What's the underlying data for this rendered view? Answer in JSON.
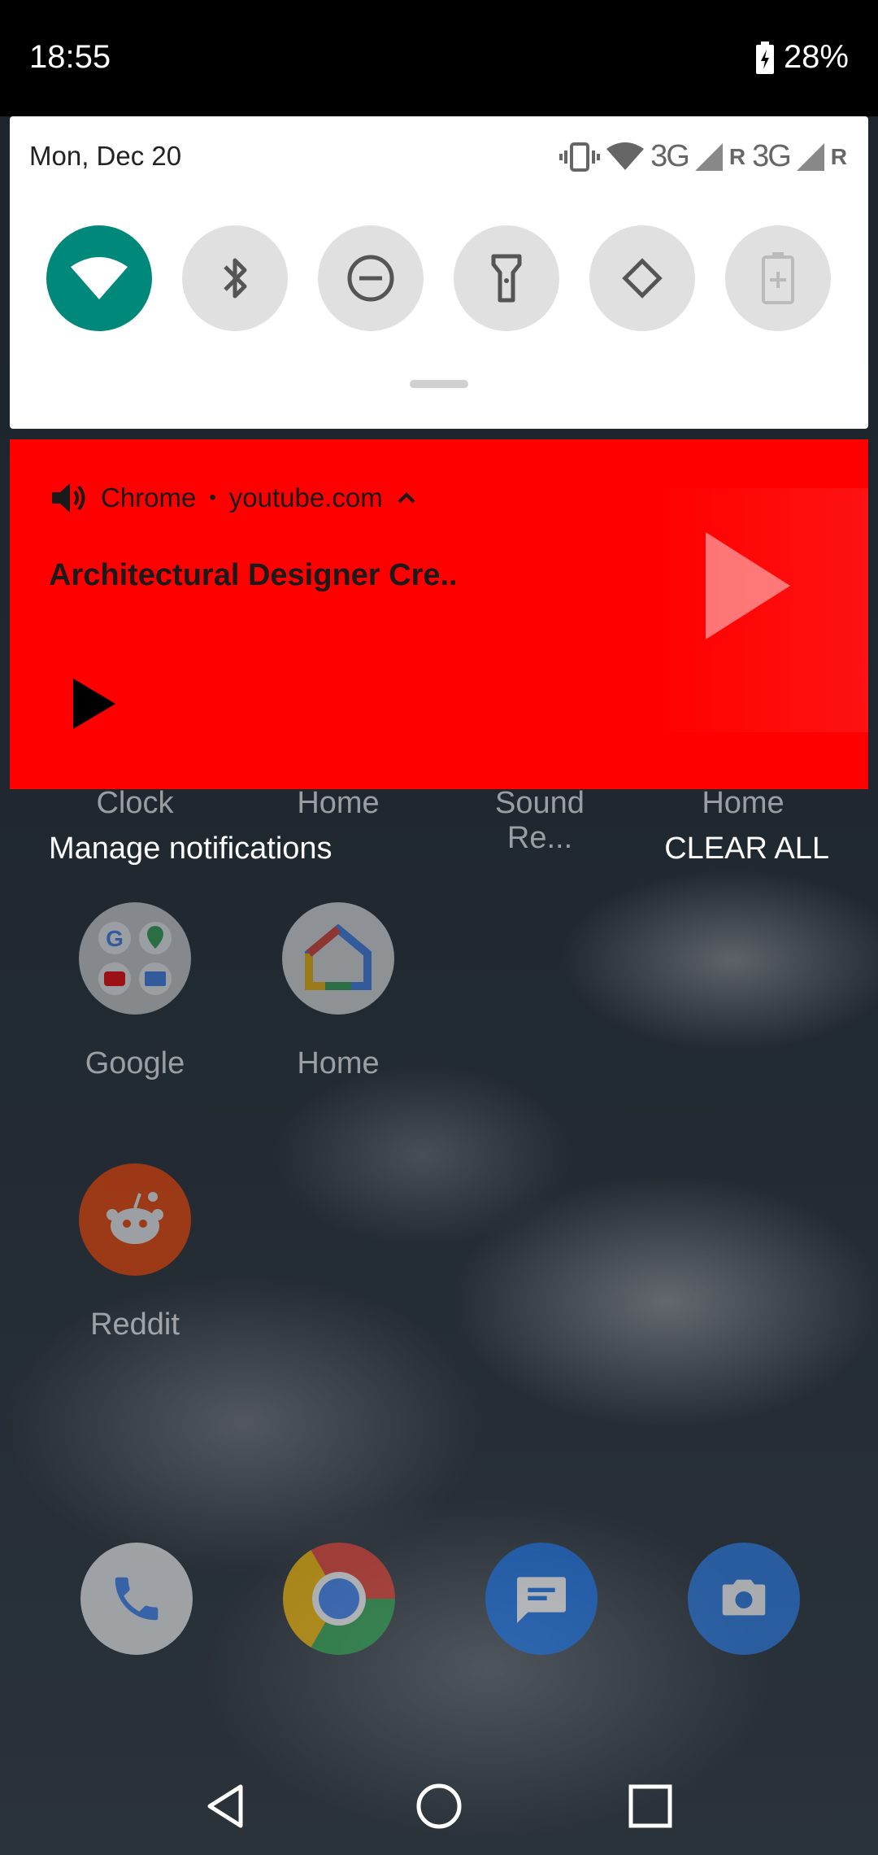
{
  "status_bar": {
    "time": "18:55",
    "battery_percent": "28%"
  },
  "quick_settings": {
    "date": "Mon, Dec 20",
    "network_labels": [
      "3G",
      "R",
      "3G",
      "R"
    ],
    "tiles": [
      {
        "name": "wifi",
        "icon": "wifi-icon",
        "active": true
      },
      {
        "name": "bluetooth",
        "icon": "bluetooth-icon",
        "active": false
      },
      {
        "name": "do-not-disturb",
        "icon": "dnd-icon",
        "active": false
      },
      {
        "name": "flashlight",
        "icon": "flashlight-icon",
        "active": false
      },
      {
        "name": "auto-rotate",
        "icon": "rotate-icon",
        "active": false
      },
      {
        "name": "battery-saver",
        "icon": "battery-saver-icon",
        "active": false
      }
    ],
    "accent_color": "#00897b"
  },
  "media_notification": {
    "app": "Chrome",
    "separator": "•",
    "site": "youtube.com",
    "title": "Architectural Designer Cre..",
    "background_color": "#ff0000"
  },
  "notification_actions": {
    "manage": "Manage notifications",
    "clear_all": "CLEAR ALL"
  },
  "home_screen": {
    "row1_labels": [
      "Clock",
      "Home",
      "Sound Re...",
      "Home"
    ],
    "apps": [
      {
        "label": "Google"
      },
      {
        "label": "Home"
      },
      {
        "label": "Reddit"
      }
    ],
    "dock": [
      "phone-icon",
      "chrome-icon",
      "messages-icon",
      "camera-icon"
    ]
  }
}
